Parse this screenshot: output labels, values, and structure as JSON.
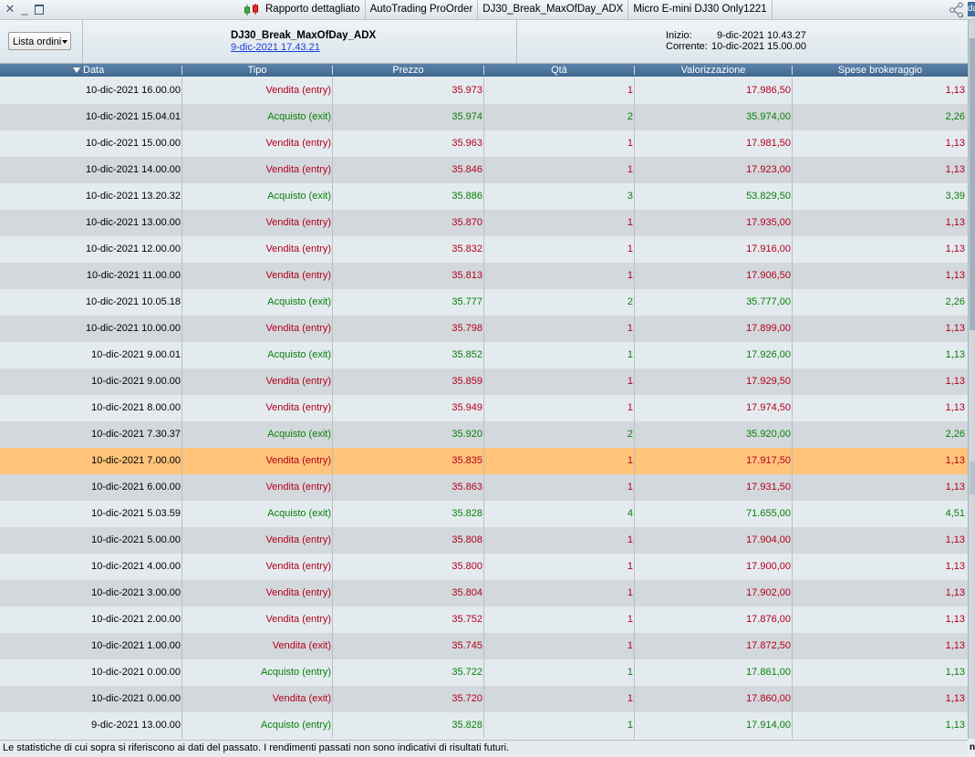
{
  "window": {
    "tabs": [
      {
        "label": "Rapporto dettagliato"
      },
      {
        "label": "AutoTrading ProOrder"
      },
      {
        "label": "DJ30_Break_MaxOfDay_ADX"
      },
      {
        "label": "Micro E-mini DJ30 Only1221"
      }
    ],
    "edge_label": "da"
  },
  "header": {
    "dropdown_label": "Lista ordini",
    "strategy_name": "DJ30_Break_MaxOfDay_ADX",
    "strategy_date": "9-dic-2021 17.43.21",
    "start_label": "Inizio:",
    "start_value": "9-dic-2021 10.43.27",
    "current_label": "Corrente:",
    "current_value": "10-dic-2021 15.00.00"
  },
  "table": {
    "columns": [
      "Data",
      "Tipo",
      "Prezzo",
      "Qtà",
      "Valorizzazione",
      "Spese brokeraggio"
    ],
    "rows": [
      {
        "data": "10-dic-2021 16.00.00",
        "tipo": "Vendita (entry)",
        "prezzo": "35.973",
        "qta": "1",
        "valore": "17.986,50",
        "spese": "1,13"
      },
      {
        "data": "10-dic-2021 15.04.01",
        "tipo": "Acquisto (exit)",
        "prezzo": "35.974",
        "qta": "2",
        "valore": "35.974,00",
        "spese": "2,26"
      },
      {
        "data": "10-dic-2021 15.00.00",
        "tipo": "Vendita (entry)",
        "prezzo": "35.963",
        "qta": "1",
        "valore": "17.981,50",
        "spese": "1,13"
      },
      {
        "data": "10-dic-2021 14.00.00",
        "tipo": "Vendita (entry)",
        "prezzo": "35.846",
        "qta": "1",
        "valore": "17.923,00",
        "spese": "1,13"
      },
      {
        "data": "10-dic-2021 13.20.32",
        "tipo": "Acquisto (exit)",
        "prezzo": "35.886",
        "qta": "3",
        "valore": "53.829,50",
        "spese": "3,39"
      },
      {
        "data": "10-dic-2021 13.00.00",
        "tipo": "Vendita (entry)",
        "prezzo": "35.870",
        "qta": "1",
        "valore": "17.935,00",
        "spese": "1,13"
      },
      {
        "data": "10-dic-2021 12.00.00",
        "tipo": "Vendita (entry)",
        "prezzo": "35.832",
        "qta": "1",
        "valore": "17.916,00",
        "spese": "1,13"
      },
      {
        "data": "10-dic-2021 11.00.00",
        "tipo": "Vendita (entry)",
        "prezzo": "35.813",
        "qta": "1",
        "valore": "17.906,50",
        "spese": "1,13"
      },
      {
        "data": "10-dic-2021 10.05.18",
        "tipo": "Acquisto (exit)",
        "prezzo": "35.777",
        "qta": "2",
        "valore": "35.777,00",
        "spese": "2,26"
      },
      {
        "data": "10-dic-2021 10.00.00",
        "tipo": "Vendita (entry)",
        "prezzo": "35.798",
        "qta": "1",
        "valore": "17.899,00",
        "spese": "1,13"
      },
      {
        "data": "10-dic-2021 9.00.01",
        "tipo": "Acquisto (exit)",
        "prezzo": "35.852",
        "qta": "1",
        "valore": "17.926,00",
        "spese": "1,13"
      },
      {
        "data": "10-dic-2021 9.00.00",
        "tipo": "Vendita (entry)",
        "prezzo": "35.859",
        "qta": "1",
        "valore": "17.929,50",
        "spese": "1,13"
      },
      {
        "data": "10-dic-2021 8.00.00",
        "tipo": "Vendita (entry)",
        "prezzo": "35.949",
        "qta": "1",
        "valore": "17.974,50",
        "spese": "1,13"
      },
      {
        "data": "10-dic-2021 7.30.37",
        "tipo": "Acquisto (exit)",
        "prezzo": "35.920",
        "qta": "2",
        "valore": "35.920,00",
        "spese": "2,26"
      },
      {
        "data": "10-dic-2021 7.00.00",
        "tipo": "Vendita (entry)",
        "prezzo": "35.835",
        "qta": "1",
        "valore": "17.917,50",
        "spese": "1,13",
        "selected": true
      },
      {
        "data": "10-dic-2021 6.00.00",
        "tipo": "Vendita (entry)",
        "prezzo": "35.863",
        "qta": "1",
        "valore": "17.931,50",
        "spese": "1,13"
      },
      {
        "data": "10-dic-2021 5.03.59",
        "tipo": "Acquisto (exit)",
        "prezzo": "35.828",
        "qta": "4",
        "valore": "71.655,00",
        "spese": "4,51"
      },
      {
        "data": "10-dic-2021 5.00.00",
        "tipo": "Vendita (entry)",
        "prezzo": "35.808",
        "qta": "1",
        "valore": "17.904,00",
        "spese": "1,13"
      },
      {
        "data": "10-dic-2021 4.00.00",
        "tipo": "Vendita (entry)",
        "prezzo": "35.800",
        "qta": "1",
        "valore": "17.900,00",
        "spese": "1,13"
      },
      {
        "data": "10-dic-2021 3.00.00",
        "tipo": "Vendita (entry)",
        "prezzo": "35.804",
        "qta": "1",
        "valore": "17.902,00",
        "spese": "1,13"
      },
      {
        "data": "10-dic-2021 2.00.00",
        "tipo": "Vendita (entry)",
        "prezzo": "35.752",
        "qta": "1",
        "valore": "17.876,00",
        "spese": "1,13"
      },
      {
        "data": "10-dic-2021 1.00.00",
        "tipo": "Vendita (exit)",
        "prezzo": "35.745",
        "qta": "1",
        "valore": "17.872,50",
        "spese": "1,13"
      },
      {
        "data": "10-dic-2021 0.00.00",
        "tipo": "Acquisto (entry)",
        "prezzo": "35.722",
        "qta": "1",
        "valore": "17.861,00",
        "spese": "1,13"
      },
      {
        "data": "10-dic-2021 0.00.00",
        "tipo": "Vendita (exit)",
        "prezzo": "35.720",
        "qta": "1",
        "valore": "17.860,00",
        "spese": "1,13"
      },
      {
        "data": "9-dic-2021 13.00.00",
        "tipo": "Acquisto (entry)",
        "prezzo": "35.828",
        "qta": "1",
        "valore": "17.914,00",
        "spese": "1,13"
      }
    ]
  },
  "footer": {
    "disclaimer": "Le statistiche di cui sopra si riferiscono ai dati del passato. I rendimenti passati non sono indicativi di risultati futuri.",
    "edge_text": "n"
  },
  "colors": {
    "sell": "#b3001b",
    "buy": "#078007",
    "header_blue": "#4a7299",
    "selected_row": "#ffc37a"
  }
}
